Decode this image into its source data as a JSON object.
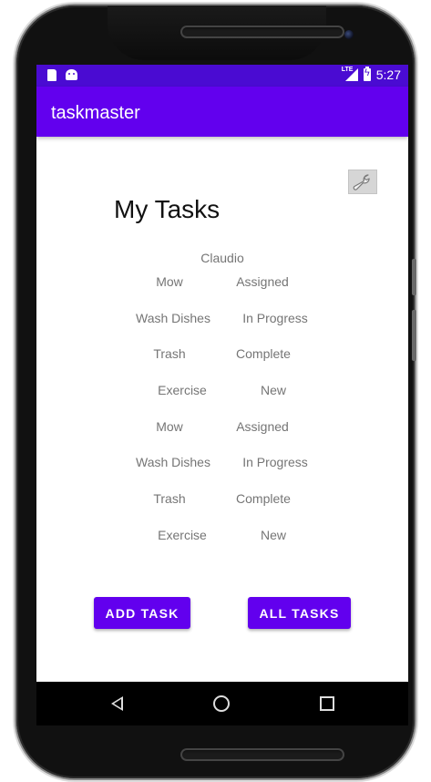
{
  "status_bar": {
    "time": "5:27",
    "network": "LTE",
    "icons": [
      "sd-card-icon",
      "android-icon",
      "lte-signal-icon",
      "battery-charging-icon"
    ]
  },
  "app_bar": {
    "title": "taskmaster"
  },
  "main": {
    "heading": "My Tasks",
    "settings_icon": "wrench-icon",
    "username": "Claudio",
    "tasks": [
      {
        "title": "Mow",
        "status": "Assigned"
      },
      {
        "title": "Wash Dishes",
        "status": "In Progress"
      },
      {
        "title": "Trash",
        "status": "Complete"
      },
      {
        "title": "Exercise",
        "status": "New"
      },
      {
        "title": "Mow",
        "status": "Assigned"
      },
      {
        "title": "Wash Dishes",
        "status": "In Progress"
      },
      {
        "title": "Trash",
        "status": "Complete"
      },
      {
        "title": "Exercise",
        "status": "New"
      }
    ],
    "add_task_label": "ADD TASK",
    "all_tasks_label": "ALL TASKS"
  },
  "nav_bar": {
    "icons": [
      "back-icon",
      "home-icon",
      "recents-icon"
    ]
  },
  "colors": {
    "primary": "#6200ee",
    "primary_dark": "#4a0bd2",
    "text_secondary": "#757575"
  }
}
